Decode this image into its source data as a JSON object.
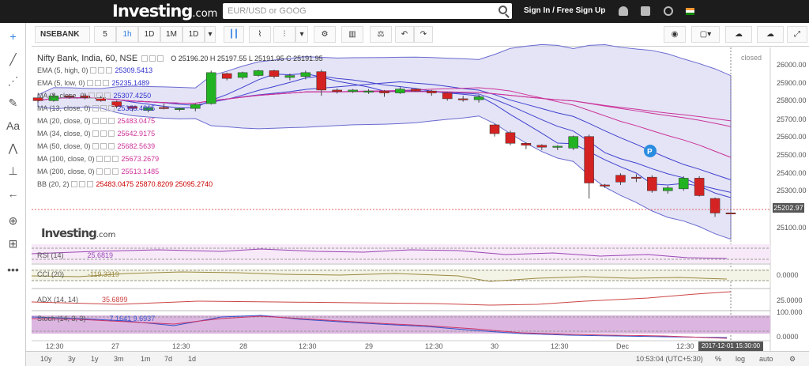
{
  "header": {
    "logo": "Investing",
    "logo_domain": ".com",
    "search_placeholder": "EUR/USD or GOOG",
    "signin": "Sign In / Free Sign Up"
  },
  "toolbar": {
    "symbol": "NSEBANK",
    "intervals": [
      "5",
      "1h",
      "1D",
      "1M",
      "1D"
    ]
  },
  "chart": {
    "title": "Nifty Bank, India, 60, NSE",
    "ohlc": "O 25196.20  H 25197.55  L 25191.95  C 25191.95",
    "status": "closed",
    "current_price": "25202.97",
    "crosshair_date": "2017-12-01 15:30:00",
    "watermark": "Investing",
    "watermark_domain": ".com",
    "legend": [
      {
        "label": "EMA (5, high, 0)",
        "value": "25309.5413",
        "color": "#3333cc"
      },
      {
        "label": "EMA (5, low, 0)",
        "value": "25235.1489",
        "color": "#3333cc"
      },
      {
        "label": "MA (8, close, 0)",
        "value": "25307.4250",
        "color": "#3333cc"
      },
      {
        "label": "MA (13, close, 0)",
        "value": "25386.4865",
        "color": "#3333cc"
      },
      {
        "label": "MA (20, close, 0)",
        "value": "25483.0475",
        "color": "#cc3399"
      },
      {
        "label": "MA (34, close, 0)",
        "value": "25642.9175",
        "color": "#cc3399"
      },
      {
        "label": "MA (50, close, 0)",
        "value": "25682.5639",
        "color": "#cc3399"
      },
      {
        "label": "MA (100, close, 0)",
        "value": "25673.2679",
        "color": "#cc3399"
      },
      {
        "label": "MA (200, close, 0)",
        "value": "25513.1485",
        "color": "#cc3399"
      },
      {
        "label": "BB (20, 2)",
        "value": "25483.0475  25870.8209  25095.2740",
        "color": "#cc0000"
      }
    ],
    "y_ticks": [
      "26000.00",
      "25900.00",
      "25800.00",
      "25700.00",
      "25600.00",
      "25500.00",
      "25400.00",
      "25300.00",
      "25100.00"
    ],
    "x_ticks": [
      "12:30",
      "27",
      "12:30",
      "28",
      "12:30",
      "29",
      "12:30",
      "30",
      "12:30",
      "Dec",
      "12:30"
    ],
    "indicators": [
      {
        "label": "RSI (14)",
        "value": "25.6819"
      },
      {
        "label": "CCI (20)",
        "value": "-119.3319"
      },
      {
        "label": "ADX (14, 14)",
        "value": "35.6899"
      },
      {
        "label": "Stoch (14, 3, 3)",
        "value": "7.1641  9.6937"
      }
    ],
    "indicator_ticks": [
      "0.0000",
      "25.0000",
      "100.000",
      "0.0000"
    ]
  },
  "bottom": {
    "ranges": [
      "10y",
      "3y",
      "1y",
      "3m",
      "1m",
      "7d",
      "1d"
    ],
    "clock": "10:53:04 (UTC+5:30)",
    "opts": [
      "%",
      "log",
      "auto"
    ]
  },
  "chart_data": {
    "type": "candlestick",
    "ylim": [
      25050,
      26050
    ],
    "candles": [
      [
        25790,
        25800,
        25765,
        25775
      ],
      [
        25775,
        25810,
        25770,
        25800
      ],
      [
        25800,
        25810,
        25785,
        25795
      ],
      [
        25800,
        25812,
        25785,
        25790
      ],
      [
        25790,
        25800,
        25770,
        25775
      ],
      [
        25770,
        25775,
        25735,
        25745
      ],
      [
        25745,
        25750,
        25720,
        25735
      ],
      [
        25725,
        25745,
        25715,
        25740
      ],
      [
        25740,
        25760,
        25730,
        25735
      ],
      [
        25730,
        25740,
        25720,
        25735
      ],
      [
        25735,
        25760,
        25720,
        25755
      ],
      [
        25760,
        25930,
        25755,
        25920
      ],
      [
        25915,
        25920,
        25880,
        25890
      ],
      [
        25895,
        25925,
        25885,
        25920
      ],
      [
        25905,
        25935,
        25900,
        25930
      ],
      [
        25930,
        25935,
        25890,
        25900
      ],
      [
        25895,
        25915,
        25880,
        25905
      ],
      [
        25900,
        25930,
        25885,
        25920
      ],
      [
        25925,
        25935,
        25800,
        25830
      ],
      [
        25830,
        25838,
        25812,
        25822
      ],
      [
        25822,
        25835,
        25815,
        25830
      ],
      [
        25820,
        25835,
        25810,
        25825
      ],
      [
        25825,
        25830,
        25795,
        25815
      ],
      [
        25815,
        25845,
        25810,
        25835
      ],
      [
        25835,
        25838,
        25820,
        25825
      ],
      [
        25825,
        25830,
        25800,
        25815
      ],
      [
        25815,
        25820,
        25775,
        25785
      ],
      [
        25785,
        25800,
        25770,
        25780
      ],
      [
        25780,
        25805,
        25765,
        25795
      ],
      [
        25650,
        25655,
        25590,
        25605
      ],
      [
        25610,
        25620,
        25545,
        25555
      ],
      [
        25555,
        25560,
        25525,
        25545
      ],
      [
        25545,
        25550,
        25520,
        25535
      ],
      [
        25535,
        25545,
        25520,
        25540
      ],
      [
        25530,
        25595,
        25520,
        25590
      ],
      [
        25590,
        25600,
        25270,
        25350
      ],
      [
        25340,
        25345,
        25325,
        25335
      ],
      [
        25390,
        25400,
        25340,
        25355
      ],
      [
        25380,
        25395,
        25355,
        25375
      ],
      [
        25380,
        25390,
        25300,
        25310
      ],
      [
        25310,
        25335,
        25295,
        25325
      ],
      [
        25320,
        25385,
        25310,
        25375
      ],
      [
        25375,
        25385,
        25280,
        25285
      ],
      [
        25270,
        25275,
        25175,
        25195
      ],
      [
        25196,
        25197,
        25191,
        25192
      ]
    ]
  }
}
